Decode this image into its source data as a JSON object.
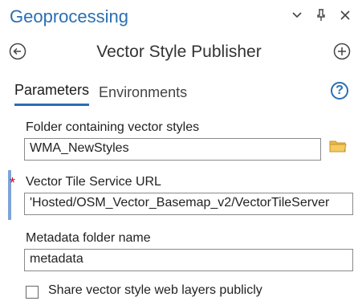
{
  "pane": {
    "title": "Geoprocessing",
    "controls": [
      "chevron-down",
      "pin",
      "close"
    ]
  },
  "tool": {
    "title": "Vector Style Publisher"
  },
  "tabs": [
    {
      "label": "Parameters",
      "active": true
    },
    {
      "label": "Environments",
      "active": false
    }
  ],
  "params": {
    "folder_label": "Folder containing vector styles",
    "folder_value": "WMA_NewStyles",
    "url_label": "Vector Tile Service URL",
    "url_value": "'Hosted/OSM_Vector_Basemap_v2/VectorTileServer",
    "metadata_label": "Metadata folder name",
    "metadata_value": "metadata",
    "share_label": "Share vector style web layers publicly",
    "share_checked": false
  },
  "colors": {
    "accent": "#2a6fb3",
    "required": "#d0021b",
    "folder": "#e8b84a"
  }
}
